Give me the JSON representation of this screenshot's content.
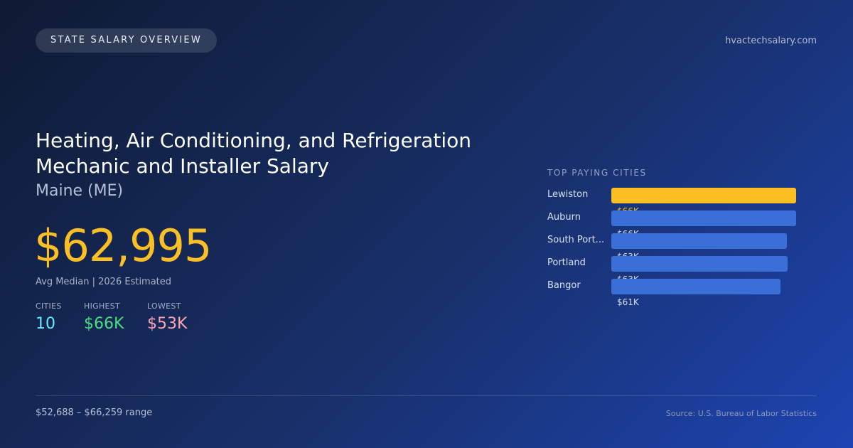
{
  "header": {
    "badge": "STATE SALARY OVERVIEW",
    "site": "hvactechsalary.com"
  },
  "main": {
    "title_line1": "Heating, Air Conditioning, and Refrigeration",
    "title_line2": "Mechanic and Installer Salary",
    "state": "Maine (ME)",
    "salary": "$62,995",
    "salary_note": "Avg Median | 2026 Estimated",
    "stats": [
      {
        "label": "CITIES",
        "value": "10"
      },
      {
        "label": "HIGHEST",
        "value": "$66K"
      },
      {
        "label": "LOWEST",
        "value": "$53K"
      }
    ]
  },
  "cities": {
    "heading": "TOP PAYING CITIES",
    "items": [
      {
        "name": "Lewiston",
        "value_label": "$66K",
        "fill": 1.0,
        "highlight": true
      },
      {
        "name": "Auburn",
        "value_label": "$66K",
        "fill": 1.0,
        "highlight": false
      },
      {
        "name": "South Port...",
        "value_label": "$63K",
        "fill": 0.95,
        "highlight": false
      },
      {
        "name": "Portland",
        "value_label": "$63K",
        "fill": 0.954,
        "highlight": false
      },
      {
        "name": "Bangor",
        "value_label": "$61K",
        "fill": 0.917,
        "highlight": false
      }
    ]
  },
  "footer": {
    "range": "$52,688 – $66,259 range",
    "source": "Source: U.S. Bureau of Labor Statistics"
  },
  "colors": {
    "accent": "#fbbf24",
    "bar": "#3b6fd8",
    "cities_value": "#67e8f9",
    "highest_value": "#4ade80",
    "lowest_value": "#fda4af"
  }
}
